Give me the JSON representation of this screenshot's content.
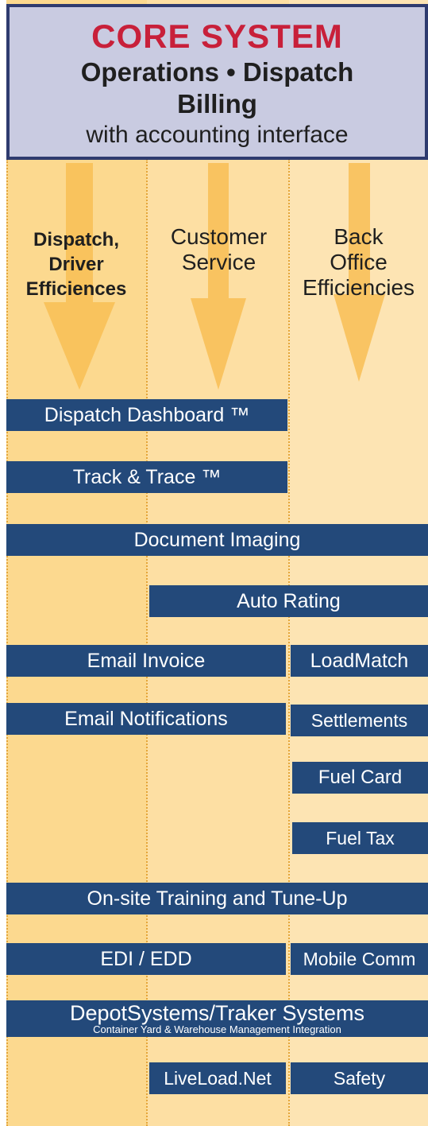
{
  "header": {
    "title": "CORE SYSTEM",
    "line1": "Operations • Dispatch",
    "line2": "Billing",
    "line3": "with accounting interface"
  },
  "columns": {
    "col1": "Dispatch,\nDriver\nEfficiences",
    "col2": "Customer\nService",
    "col3": "Back\nOffice\nEfficiencies"
  },
  "bars": {
    "dispatch_dashboard": "Dispatch Dashboard ™",
    "track_trace": "Track & Trace ™",
    "document_imaging": "Document Imaging",
    "auto_rating": "Auto Rating",
    "email_invoice": "Email Invoice",
    "loadmatch": "LoadMatch",
    "email_notifications": "Email Notifications",
    "settlements": "Settlements",
    "fuel_card": "Fuel Card",
    "fuel_tax": "Fuel Tax",
    "onsite_training": "On-site Training and Tune-Up",
    "edi_edd": "EDI / EDD",
    "mobile_comm": "Mobile Comm",
    "depot_systems": "DepotSystems/Traker Systems",
    "depot_systems_sub": "Container Yard & Warehouse Management Integration",
    "liveload": "LiveLoad.Net",
    "safety": "Safety"
  },
  "colors": {
    "title_red": "#c8203a",
    "bar_navy": "#23497a",
    "header_bg": "#c9cbe1",
    "arrow_orange": "#f8be55"
  }
}
